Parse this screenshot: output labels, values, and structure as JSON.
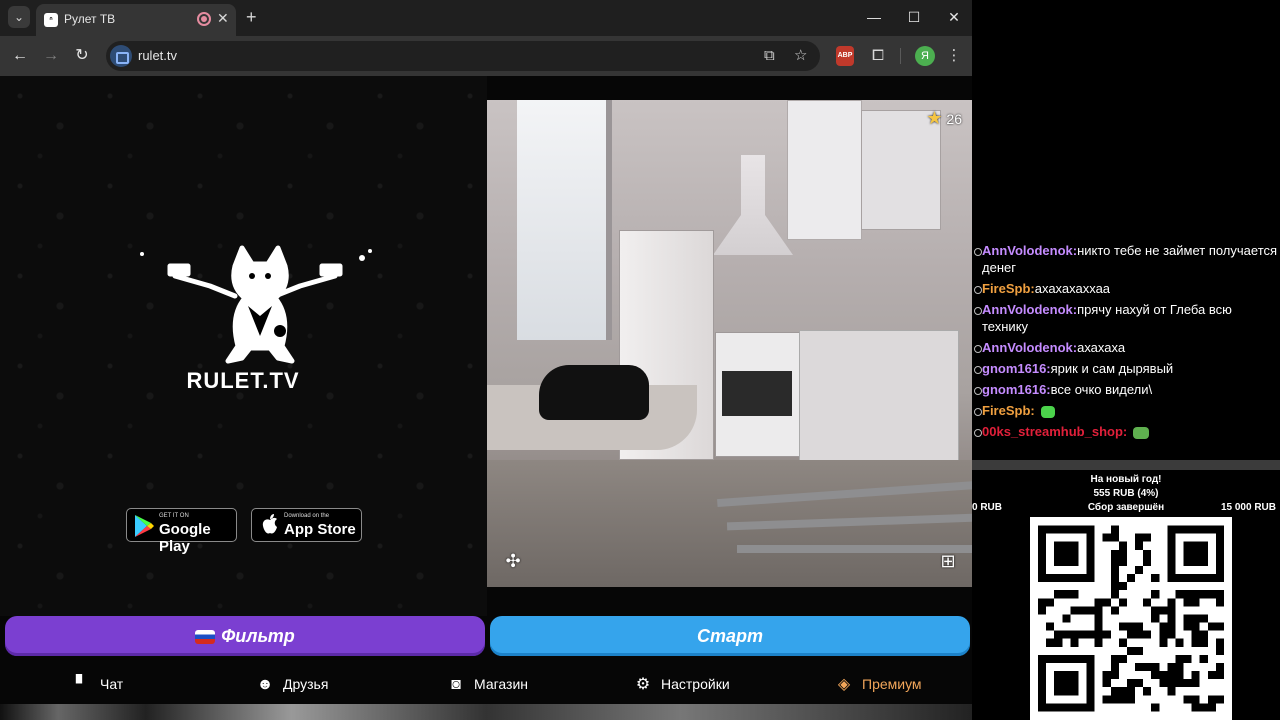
{
  "browser": {
    "tab_title": "Рулет ТВ",
    "url": "rulet.tv",
    "profile_letter": "Я",
    "abp_label": "ABP"
  },
  "site": {
    "logo_text": "RULET.TV",
    "google_play": {
      "small": "GET IT ON",
      "big": "Google Play"
    },
    "app_store": {
      "small": "Download on the",
      "big": "App Store"
    },
    "favorites_count": "26",
    "filter_button": "Фильтр",
    "start_button": "Старт",
    "nav": [
      {
        "label": "Чат",
        "icon": "chat-icon"
      },
      {
        "label": "Друзья",
        "icon": "friends-icon"
      },
      {
        "label": "Магазин",
        "icon": "shop-bag-icon"
      },
      {
        "label": "Настройки",
        "icon": "gear-icon"
      },
      {
        "label": "Премиум",
        "icon": "tag-icon"
      }
    ]
  },
  "overlay": {
    "colors": {
      "purple_user": "#c58cff",
      "orange_user": "#f0a040",
      "red_user": "#e0203a"
    },
    "chat": [
      {
        "user": "AnnVolodenok:",
        "text": "никто тебе не займет получается денег",
        "color": "#c58cff"
      },
      {
        "user": "FireSpb:",
        "text": "ахахахаххаа",
        "color": "#f0a040"
      },
      {
        "user": "AnnVolodenok:",
        "text": "прячу нахуй от Глеба всю технику",
        "color": "#c58cff"
      },
      {
        "user": "AnnVolodenok:",
        "text": "ахахаха",
        "color": "#c58cff"
      },
      {
        "user": "gnom1616:",
        "text": "ярик и сам дырявый",
        "color": "#c58cff"
      },
      {
        "user": "gnom1616:",
        "text": "все очко видели\\",
        "color": "#c58cff"
      },
      {
        "user": "FireSpb:",
        "text": "",
        "color": "#f0a040"
      },
      {
        "user": "00ks_streamhub_shop:",
        "text": "",
        "color": "#e0203a"
      }
    ],
    "goal": {
      "title": "На новый год!",
      "amount": "555 RUB (4%)",
      "min": "0 RUB",
      "status": "Сбор завершён",
      "max": "15 000 RUB"
    }
  }
}
